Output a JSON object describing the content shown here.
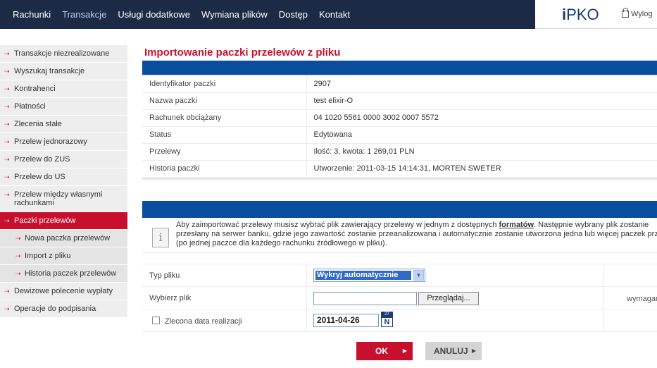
{
  "topnav": {
    "items": [
      "Rachunki",
      "Transakcje",
      "Usługi dodatkowe",
      "Wymiana plików",
      "Dostęp",
      "Kontakt"
    ],
    "active_index": 1
  },
  "brand": {
    "logo_i": "i",
    "logo_text": "PKO",
    "logout_label": "Wylog"
  },
  "sidebar": {
    "items": [
      {
        "label": "Transakcje niezrealizowane",
        "type": "main"
      },
      {
        "label": "Wyszukaj transakcje",
        "type": "main"
      },
      {
        "label": "Kontrahenci",
        "type": "main"
      },
      {
        "label": "Płatności",
        "type": "main"
      },
      {
        "label": "Zlecenia stałe",
        "type": "main"
      },
      {
        "label": "Przelew jednorazowy",
        "type": "main"
      },
      {
        "label": "Przelew do ZUS",
        "type": "main"
      },
      {
        "label": "Przelew do US",
        "type": "main"
      },
      {
        "label": "Przelew między własnymi rachunkami",
        "type": "main"
      },
      {
        "label": "Paczki przelewów",
        "type": "active"
      },
      {
        "label": "Nowa paczka przelewów",
        "type": "sub"
      },
      {
        "label": "Import z pliku",
        "type": "sub"
      },
      {
        "label": "Historia paczek przelewów",
        "type": "sub"
      },
      {
        "label": "Dewizowe polecenie wypłaty",
        "type": "main"
      },
      {
        "label": "Operacje do podpisania",
        "type": "main"
      }
    ]
  },
  "main": {
    "title": "Importowanie paczki przelewów z pliku",
    "details": [
      {
        "label": "Identyfikator paczki",
        "value": "2907"
      },
      {
        "label": "Nazwa paczki",
        "value": "test elixir-O"
      },
      {
        "label": "Rachunek obciążany",
        "value": "04 1020 5561 0000 3002 0007 5572"
      },
      {
        "label": "Status",
        "value": "Edytowana"
      },
      {
        "label": "Przelewy",
        "value": "Ilość: 3, kwota: 1 269,01 PLN"
      },
      {
        "label": "Historia paczki",
        "value": "Utworzenie: 2011-03-15 14:14:31, MORTEN SWETER"
      }
    ],
    "notice": {
      "line1_pre": "Aby zaimportować przelewy musisz wybrać plik zawierający przelewy w jednym z dostępnych ",
      "line1_link": "formatów",
      "line1_post": ". Następnie wybrany plik zostanie",
      "line2": "przesłany na serwer banku, gdzie jego zawartość zostanie przeanalizowana i automatycznie zostanie utworzona jedna lub więcej paczek przelewów",
      "line3": "(po jednej paczce dla każdego rachunku źródłowego w pliku)."
    },
    "form": {
      "file_type_label": "Typ pliku",
      "file_type_value": "Wykryj automatycznie",
      "choose_file_label": "Wybierz plik",
      "browse_label": "Przeglądaj...",
      "required_label": "wymagane",
      "date_label": "Zlecona data realizacji",
      "date_value": "2011-04-26",
      "calendar_top": "27",
      "calendar_letter": "N"
    },
    "buttons": {
      "ok": "OK",
      "cancel": "ANULUJ"
    }
  },
  "colors": {
    "brand_red": "#c8102e",
    "nav_dark": "#1b2b45",
    "section_blue": "#0a4d9f"
  }
}
